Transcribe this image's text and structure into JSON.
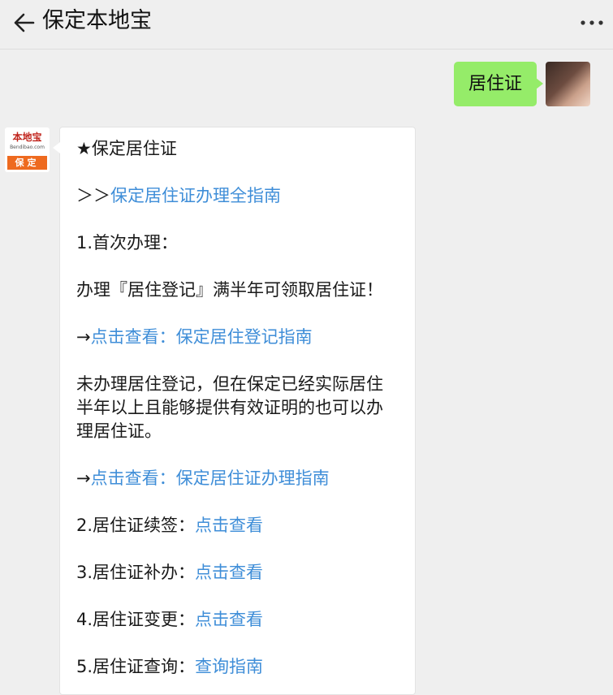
{
  "header": {
    "title": "保定本地宝"
  },
  "chat": {
    "user_message": "居住证",
    "bot_avatar": {
      "brand": "本地宝",
      "domain": "Bendibao.com",
      "city": "保定"
    },
    "bot_message": {
      "heading": "★保定居住证",
      "guide_prefix": "＞＞",
      "guide_link": "保定居住证办理全指南",
      "first_title": "1.首次办理：",
      "first_desc": "办理『居住登记』满半年可领取居住证！",
      "arrow": "→",
      "link_register": "点击查看：保定居住登记指南",
      "unregistered_desc": "未办理居住登记，但在保定已经实际居住半年以上且能够提供有效证明的也可以办理居住证。",
      "link_process": "点击查看：保定居住证办理指南",
      "renew_label": "2.居住证续签：",
      "renew_link": "点击查看",
      "reissue_label": "3.居住证补办：",
      "reissue_link": "点击查看",
      "change_label": "4.居住证变更：",
      "change_link": "点击查看",
      "query_label": "5.居住证查询：",
      "query_link": "查询指南"
    }
  }
}
